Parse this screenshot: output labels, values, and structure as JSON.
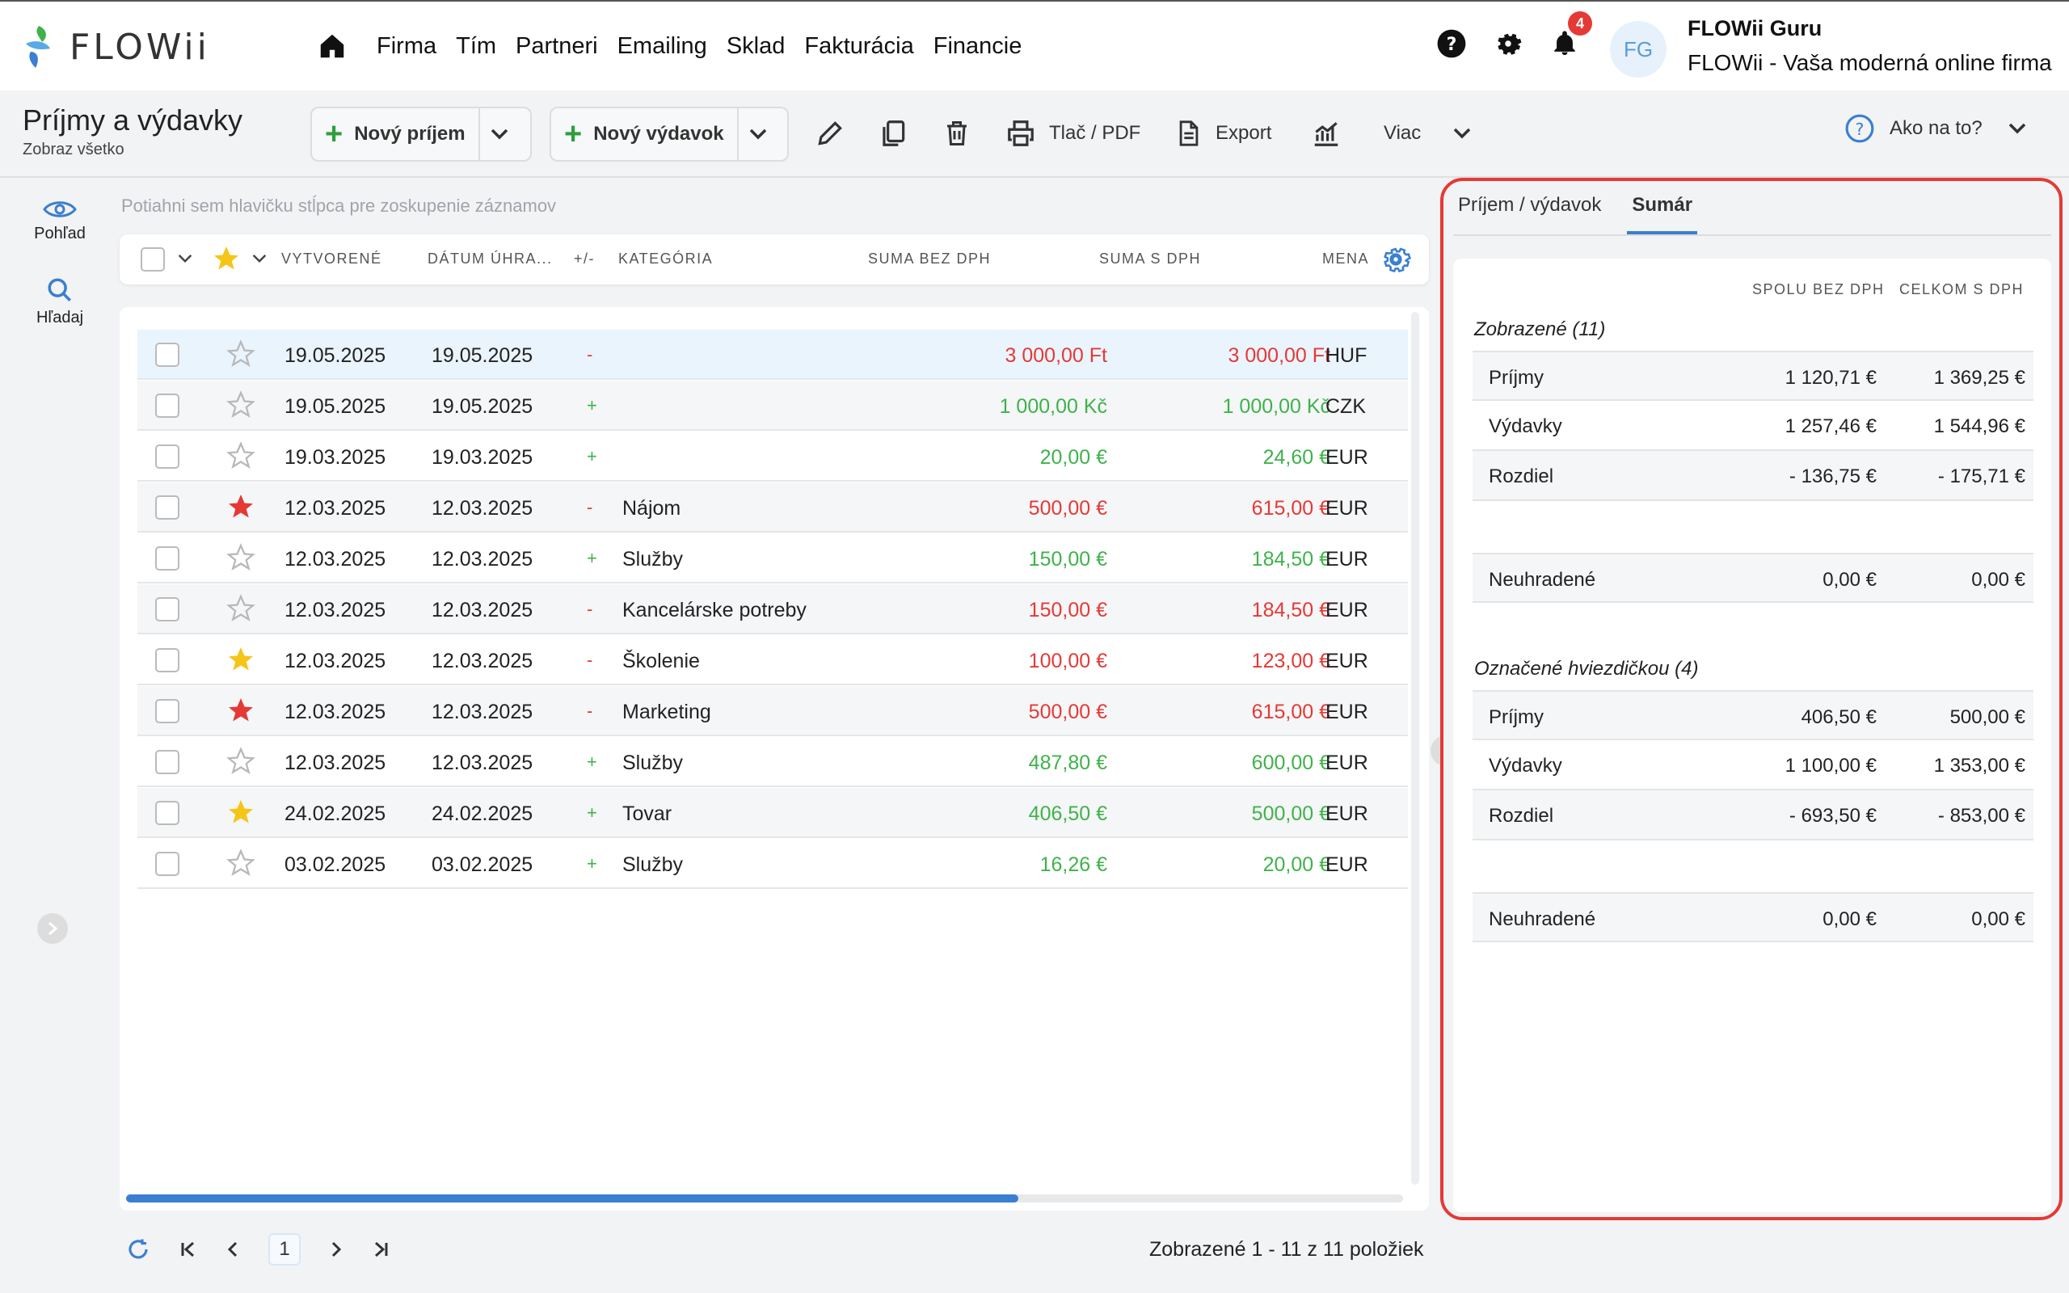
{
  "brand": {
    "name": "FLOWii"
  },
  "nav": [
    "Firma",
    "Tím",
    "Partneri",
    "Emailing",
    "Sklad",
    "Fakturácia",
    "Financie"
  ],
  "notifications": {
    "count": "4"
  },
  "user": {
    "initials": "FG",
    "name": "FLOWii Guru",
    "company": "FLOWii - Vaša moderná online firma"
  },
  "page": {
    "title": "Príjmy a výdavky",
    "subtitle": "Zobraz všetko"
  },
  "toolbar": {
    "new_income": "Nový príjem",
    "new_expense": "Nový výdavok",
    "print": "Tlač / PDF",
    "export": "Export",
    "more": "Viac",
    "help": "Ako na to?"
  },
  "rail": {
    "view": "Pohľad",
    "search": "Hľadaj"
  },
  "grid": {
    "group_hint": "Potiahni sem hlavičku stĺpca pre zoskupenie záznamov",
    "headers": {
      "created": "VYTVORENÉ",
      "paid_date": "DÁTUM ÚHRA...",
      "sign": "+/-",
      "category": "KATEGÓRIA",
      "sum_no_vat": "SUMA BEZ DPH",
      "sum_vat": "SUMA S DPH",
      "currency": "MENA"
    },
    "rows": [
      {
        "starred": "none",
        "created": "19.05.2025",
        "paid": "19.05.2025",
        "sign": "-",
        "category": "",
        "sum_no_vat": "3 000,00 Ft",
        "sum_vat": "3 000,00 Ft",
        "currency": "HUF",
        "type": "expense"
      },
      {
        "starred": "none",
        "created": "19.05.2025",
        "paid": "19.05.2025",
        "sign": "+",
        "category": "",
        "sum_no_vat": "1 000,00 Kč",
        "sum_vat": "1 000,00 Kč",
        "currency": "CZK",
        "type": "income"
      },
      {
        "starred": "none",
        "created": "19.03.2025",
        "paid": "19.03.2025",
        "sign": "+",
        "category": "",
        "sum_no_vat": "20,00 €",
        "sum_vat": "24,60 €",
        "currency": "EUR",
        "type": "income"
      },
      {
        "starred": "red",
        "created": "12.03.2025",
        "paid": "12.03.2025",
        "sign": "-",
        "category": "Nájom",
        "sum_no_vat": "500,00 €",
        "sum_vat": "615,00 €",
        "currency": "EUR",
        "type": "expense"
      },
      {
        "starred": "none",
        "created": "12.03.2025",
        "paid": "12.03.2025",
        "sign": "+",
        "category": "Služby",
        "sum_no_vat": "150,00 €",
        "sum_vat": "184,50 €",
        "currency": "EUR",
        "type": "income"
      },
      {
        "starred": "none",
        "created": "12.03.2025",
        "paid": "12.03.2025",
        "sign": "-",
        "category": "Kancelárske potreby",
        "sum_no_vat": "150,00 €",
        "sum_vat": "184,50 €",
        "currency": "EUR",
        "type": "expense"
      },
      {
        "starred": "yellow",
        "created": "12.03.2025",
        "paid": "12.03.2025",
        "sign": "-",
        "category": "Školenie",
        "sum_no_vat": "100,00 €",
        "sum_vat": "123,00 €",
        "currency": "EUR",
        "type": "expense"
      },
      {
        "starred": "red",
        "created": "12.03.2025",
        "paid": "12.03.2025",
        "sign": "-",
        "category": "Marketing",
        "sum_no_vat": "500,00 €",
        "sum_vat": "615,00 €",
        "currency": "EUR",
        "type": "expense"
      },
      {
        "starred": "none",
        "created": "12.03.2025",
        "paid": "12.03.2025",
        "sign": "+",
        "category": "Služby",
        "sum_no_vat": "487,80 €",
        "sum_vat": "600,00 €",
        "currency": "EUR",
        "type": "income"
      },
      {
        "starred": "yellow",
        "created": "24.02.2025",
        "paid": "24.02.2025",
        "sign": "+",
        "category": "Tovar",
        "sum_no_vat": "406,50 €",
        "sum_vat": "500,00 €",
        "currency": "EUR",
        "type": "income"
      },
      {
        "starred": "none",
        "created": "03.02.2025",
        "paid": "03.02.2025",
        "sign": "+",
        "category": "Služby",
        "sum_no_vat": "16,26 €",
        "sum_vat": "20,00 €",
        "currency": "EUR",
        "type": "income"
      }
    ]
  },
  "pager": {
    "page": "1",
    "info": "Zobrazené 1 - 11 z 11 položiek"
  },
  "panel": {
    "tabs": [
      "Príjem / výdavok",
      "Sumár"
    ],
    "col_no_vat": "SPOLU BEZ DPH",
    "col_vat": "CELKOM S DPH",
    "shown": {
      "title": "Zobrazené (11)",
      "income": {
        "label": "Príjmy",
        "no_vat": "1 120,71 €",
        "vat": "1 369,25 €"
      },
      "expense": {
        "label": "Výdavky",
        "no_vat": "1 257,46 €",
        "vat": "1 544,96 €"
      },
      "diff": {
        "label": "Rozdiel",
        "no_vat": "- 136,75 €",
        "vat": "- 175,71 €"
      },
      "unpaid": {
        "label": "Neuhradené",
        "no_vat": "0,00 €",
        "vat": "0,00 €"
      }
    },
    "starred": {
      "title": "Označené hviezdičkou (4)",
      "income": {
        "label": "Príjmy",
        "no_vat": "406,50 €",
        "vat": "500,00 €"
      },
      "expense": {
        "label": "Výdavky",
        "no_vat": "1 100,00 €",
        "vat": "1 353,00 €"
      },
      "diff": {
        "label": "Rozdiel",
        "no_vat": "- 693,50 €",
        "vat": "- 853,00 €"
      },
      "unpaid": {
        "label": "Neuhradené",
        "no_vat": "0,00 €",
        "vat": "0,00 €"
      }
    }
  },
  "colors": {
    "accent": "#3a7fd0",
    "income": "#3fb24a",
    "expense": "#e53935",
    "star_red": "#e53935",
    "star_yellow": "#f5c518"
  }
}
